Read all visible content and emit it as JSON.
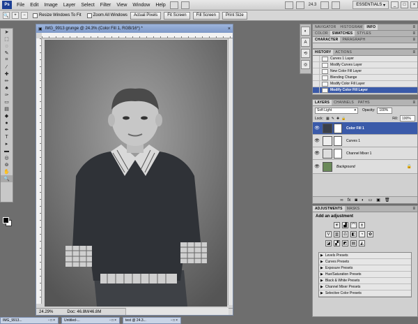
{
  "menubar": {
    "logo": "Ps",
    "items": [
      "File",
      "Edit",
      "Image",
      "Layer",
      "Select",
      "Filter",
      "View",
      "Window",
      "Help"
    ],
    "zoom_value": "24.3",
    "workspace": "ESSENTIALS"
  },
  "options": {
    "resize_windows_label": "Resize Windows To Fit",
    "zoom_all_label": "Zoom All Windows",
    "buttons": [
      "Actual Pixels",
      "Fit Screen",
      "Fill Screen",
      "Print Size"
    ]
  },
  "document": {
    "title": "IMG_9913 grunge @ 24.3% (Color Fill 1, RGB/16*) *",
    "zoom": "24.29%",
    "doc_info": "Doc: 46.8M/46.8M"
  },
  "panels": {
    "top_tabs": [
      "NAVIGATOR",
      "HISTOGRAM",
      "INFO"
    ],
    "color_tabs": [
      "COLOR",
      "SWATCHES",
      "STYLES"
    ],
    "char_tabs": [
      "CHARACTER",
      "PARAGRAPH"
    ],
    "history_tabs": [
      "HISTORY",
      "ACTIONS"
    ],
    "history_items": [
      "Curves 1 Layer",
      "Modify Curves Layer",
      "New Color Fill Layer",
      "Blending Change",
      "Modify Color Fill Layer",
      "Modify Color Fill Layer"
    ],
    "layers_tabs": [
      "LAYERS",
      "CHANNELS",
      "PATHS"
    ],
    "blend_mode": "Soft Light",
    "opacity_label": "Opacity:",
    "opacity_value": "100%",
    "lock_label": "Lock:",
    "fill_label": "Fill:",
    "fill_value": "100%",
    "layers": [
      "Color Fill 1",
      "Curves 1",
      "Channel Mixer 1",
      "Background"
    ],
    "adj_tabs": [
      "ADJUSTMENTS",
      "MASKS"
    ],
    "adj_title": "Add an adjustment",
    "presets": [
      "Levels Presets",
      "Curves Presets",
      "Exposure Presets",
      "Hue/Saturation Presets",
      "Black & White Presets",
      "Channel Mixer Presets",
      "Selective Color Presets"
    ]
  },
  "taskbar": [
    "IMG_9913...",
    "Untitled-...",
    "test @ 24.3..."
  ]
}
